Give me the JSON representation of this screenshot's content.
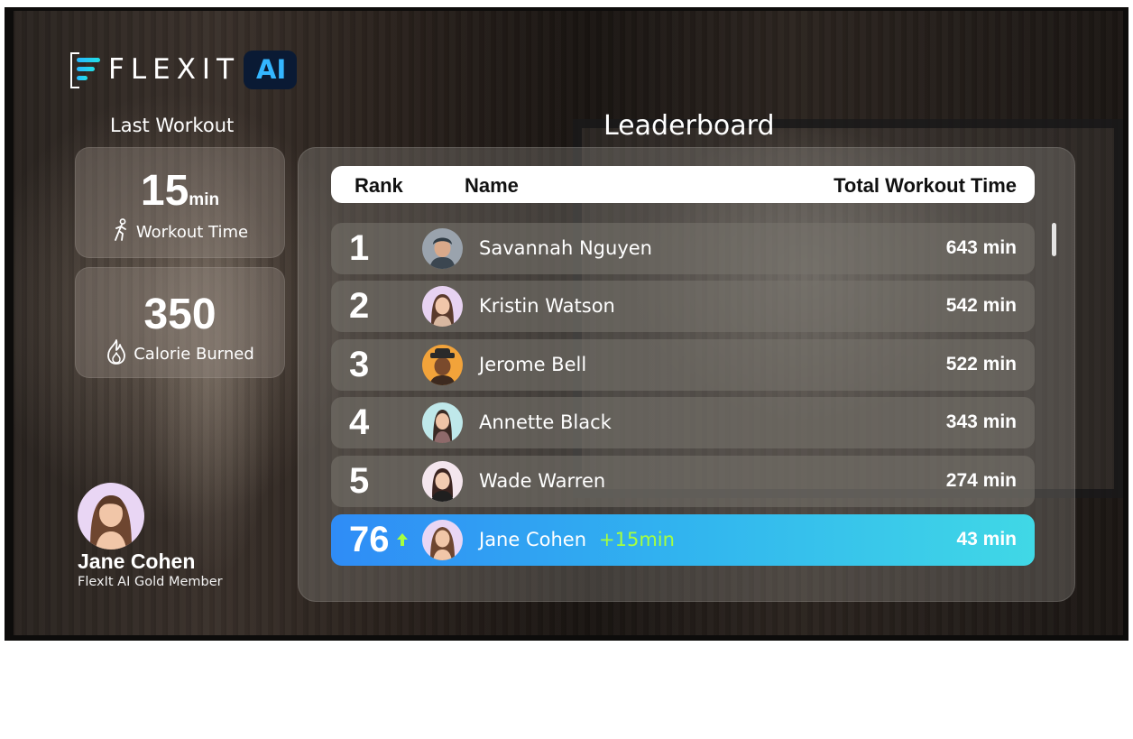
{
  "brand": {
    "name": "FLEXIT",
    "badge": "AI"
  },
  "last_workout": {
    "title": "Last Workout",
    "workout_time": {
      "value": "15",
      "unit": "min",
      "label": "Workout Time",
      "icon": "running-person-icon"
    },
    "calories": {
      "value": "350",
      "label": "Calorie Burned",
      "icon": "flame-icon"
    }
  },
  "profile": {
    "name": "Jane Cohen",
    "membership": "FlexIt AI Gold Member"
  },
  "leaderboard": {
    "title": "Leaderboard",
    "columns": {
      "rank": "Rank",
      "name": "Name",
      "time": "Total Workout Time"
    },
    "rows": [
      {
        "rank": "1",
        "name": "Savannah Nguyen",
        "time": "643 min"
      },
      {
        "rank": "2",
        "name": "Kristin Watson",
        "time": "542 min"
      },
      {
        "rank": "3",
        "name": "Jerome Bell",
        "time": "522 min"
      },
      {
        "rank": "4",
        "name": "Annette Black",
        "time": "343 min"
      },
      {
        "rank": "5",
        "name": "Wade Warren",
        "time": "274 min"
      }
    ],
    "current_user": {
      "rank": "76",
      "name": "Jane Cohen",
      "delta": "+15min",
      "time": "43 min",
      "trend_icon": "arrow-up-icon"
    }
  },
  "colors": {
    "accent_blue": "#2f8cf6",
    "accent_cyan": "#40d8e6",
    "delta_green": "#a6ff3f"
  }
}
